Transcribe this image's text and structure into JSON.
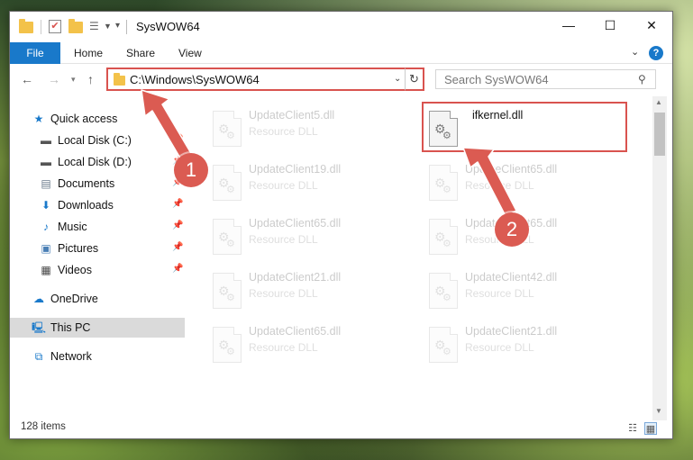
{
  "window": {
    "title": "SysWOW64",
    "minimize": "—",
    "maximize": "☐",
    "close": "✕"
  },
  "ribbon": {
    "tabs": [
      "File",
      "Home",
      "Share",
      "View"
    ],
    "help": "?"
  },
  "address": {
    "path": "C:\\Windows\\SysWOW64",
    "refresh": "↻"
  },
  "search": {
    "placeholder": "Search SysWOW64"
  },
  "sidebar": {
    "items": [
      {
        "label": "Quick access",
        "icon": "star-icon",
        "pinned": false
      },
      {
        "label": "Local Disk (C:)",
        "icon": "drive-icon",
        "pinned": true
      },
      {
        "label": "Local Disk (D:)",
        "icon": "drive-icon",
        "pinned": true
      },
      {
        "label": "Documents",
        "icon": "documents-icon",
        "pinned": true
      },
      {
        "label": "Downloads",
        "icon": "download-icon",
        "pinned": true
      },
      {
        "label": "Music",
        "icon": "music-icon",
        "pinned": true
      },
      {
        "label": "Pictures",
        "icon": "pictures-icon",
        "pinned": true
      },
      {
        "label": "Videos",
        "icon": "videos-icon",
        "pinned": true
      },
      {
        "label": "OneDrive",
        "icon": "cloud-icon",
        "pinned": false
      },
      {
        "label": "This PC",
        "icon": "computer-icon",
        "pinned": false,
        "selected": true
      },
      {
        "label": "Network",
        "icon": "network-icon",
        "pinned": false
      }
    ]
  },
  "files": [
    {
      "name": "UpdateClient5.dll",
      "type": "Resource DLL",
      "faded": true
    },
    {
      "name": "ifkernel.dll",
      "type": "",
      "faded": false,
      "highlighted": true
    },
    {
      "name": "UpdateClient19.dll",
      "type": "Resource DLL",
      "faded": true
    },
    {
      "name": "UpdateClient65.dll",
      "type": "Resource DLL",
      "faded": true
    },
    {
      "name": "UpdateClient65.dll",
      "type": "Resource DLL",
      "faded": true
    },
    {
      "name": "UpdateClient65.dll",
      "type": "Resource DLL",
      "faded": true
    },
    {
      "name": "UpdateClient21.dll",
      "type": "Resource DLL",
      "faded": true
    },
    {
      "name": "UpdateClient42.dll",
      "type": "Resource DLL",
      "faded": true
    },
    {
      "name": "UpdateClient65.dll",
      "type": "Resource DLL",
      "faded": true
    },
    {
      "name": "UpdateClient21.dll",
      "type": "Resource DLL",
      "faded": true
    }
  ],
  "status": {
    "item_count": "128 items"
  },
  "annotations": [
    "1",
    "2"
  ],
  "colors": {
    "accent": "#1979ca",
    "highlight": "#d9534f",
    "annotation": "#db5b52"
  }
}
